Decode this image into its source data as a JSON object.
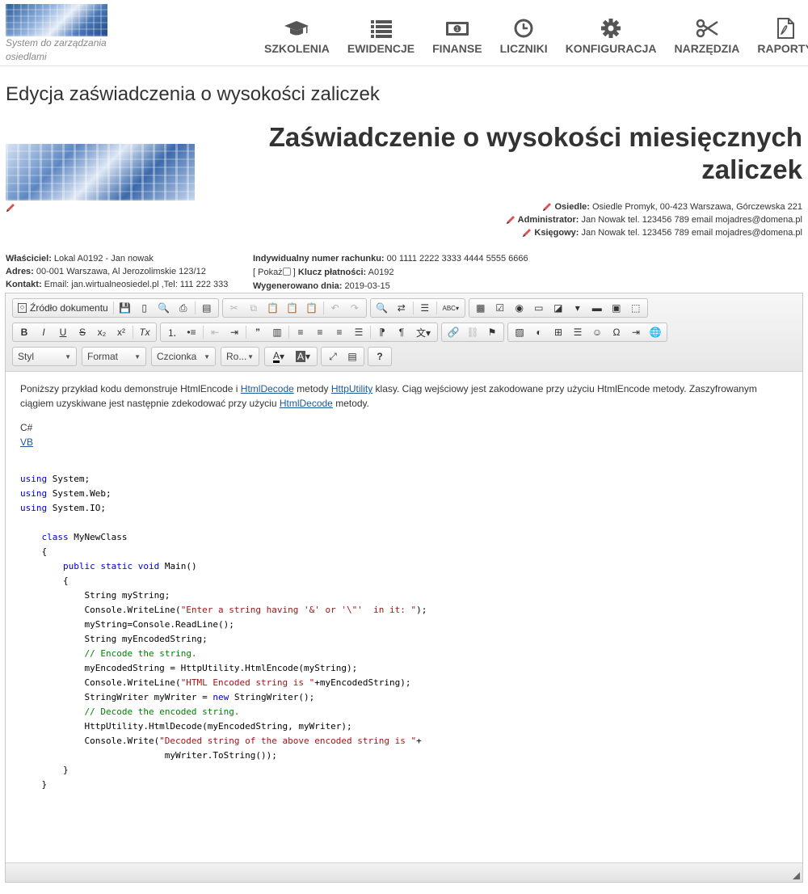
{
  "header": {
    "logo_caption": "System do zarządzania osiedlami",
    "nav": [
      {
        "label": "SZKOLENIA",
        "icon": "graduation-cap-icon"
      },
      {
        "label": "EWIDENCJE",
        "icon": "list-icon"
      },
      {
        "label": "FINANSE",
        "icon": "money-icon"
      },
      {
        "label": "LICZNIKI",
        "icon": "clock-icon"
      },
      {
        "label": "KONFIGURACJA",
        "icon": "gear-icon"
      },
      {
        "label": "NARZĘDZIA",
        "icon": "scissors-icon"
      },
      {
        "label": "RAPORTY",
        "icon": "pdf-icon"
      }
    ]
  },
  "page_title": "Edycja zaświadczenia o wysokości zaliczek",
  "document": {
    "title": "Zaświadczenie o wysokości miesięcznych zaliczek",
    "osiedle_label": "Osiedle:",
    "osiedle_value": "Osiedle Promyk, 00-423 Warszawa, Górczewska 221",
    "administrator_label": "Administrator:",
    "administrator_value": "Jan Nowak tel. 123456 789 email mojadres@domena.pl",
    "ksiegowy_label": "Księgowy:",
    "ksiegowy_value": "Jan Nowak tel. 123456 789 email mojadres@domena.pl",
    "wlasciciel_label": "Właściciel:",
    "wlasciciel_value": "Lokal A0192 - Jan nowak",
    "adres_label": "Adres:",
    "adres_value": "00-001 Warszawa, Al Jerozolimskie 123/12",
    "kontakt_label": "Kontakt:",
    "kontakt_value": "Email: jan.wirtualneosiedel.pl ,Tel: 111 222 333",
    "rachunek_label": "Indywidualny numer rachunku:",
    "rachunek_value": "00 1111 2222 3333 4444 5555 6666",
    "pokaz_open": "[ Pokaż",
    "pokaz_close": "]",
    "klucz_label": "Klucz płatności:",
    "klucz_value": "A0192",
    "wygenerowano_label": "Wygenerowano dnia:",
    "wygenerowano_value": "2019-03-15"
  },
  "editor": {
    "source_label": "Źródło dokumentu",
    "combos": {
      "styl": "Styl",
      "format": "Format",
      "czcionka": "Czcionka",
      "rozmiar": "Ro..."
    },
    "content": {
      "p_before1": "Poniższy przykład kodu demonstruje HtmlEncode i ",
      "link1": "HtmlDecode",
      "p_mid1": " metody ",
      "link2": "HttpUtility",
      "p_mid2": " klasy. Ciąg wejściowy jest zakodowane przy użyciu HtmlEncode metody. Zaszyfrowanym ciągiem uzyskiwane jest następnie zdekodować przy użyciu ",
      "link3": "HtmlDecode",
      "p_after": " metody.",
      "lang1": "C#",
      "lang2": "VB"
    }
  }
}
